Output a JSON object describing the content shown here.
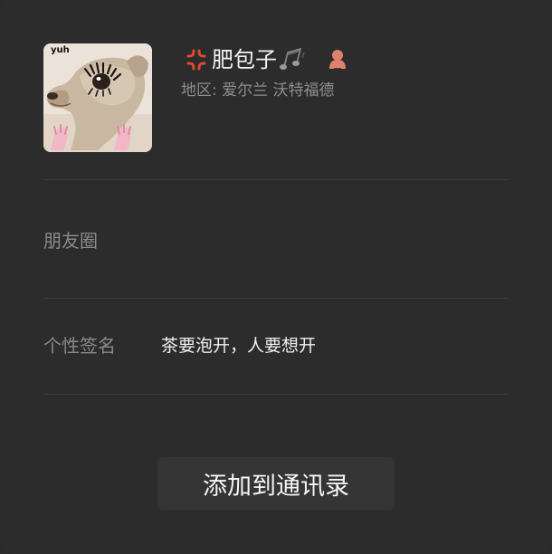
{
  "profile": {
    "avatar_tag": "yuh",
    "name_prefix_icon": "anger-symbol-icon",
    "name": "肥包子",
    "name_suffix_icon": "music-notes-icon",
    "gender_icon": "female-icon",
    "region_label": "地区: 爱尔兰 沃特福德"
  },
  "rows": {
    "moments_label": "朋友圈",
    "signature_label": "个性签名",
    "signature_value": "茶要泡开，人要想开"
  },
  "actions": {
    "add_contact_label": "添加到通讯录"
  },
  "colors": {
    "background": "#2c2c2c",
    "divider": "#3d3d3d",
    "button_bg": "#353535",
    "anger_icon": "#e04a2e",
    "gender_icon": "#e0806f"
  }
}
